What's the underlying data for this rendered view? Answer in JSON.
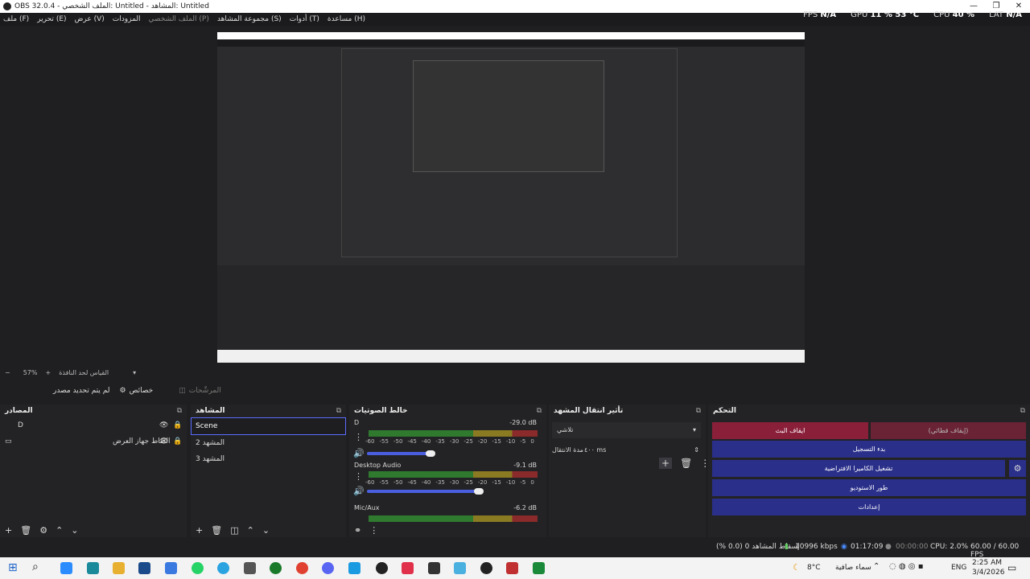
{
  "window": {
    "title": "OBS 32.0.4 - الملف الشخصي: Untitled - المشاهد: Untitled"
  },
  "menu": [
    "ملف (F)",
    "تحرير (E)",
    "عرض (V)",
    "المزودات",
    "الملف الشخصي (P)",
    "مجموعة المشاهد (S)",
    "أدوات (T)",
    "مساعدة (H)"
  ],
  "stats": {
    "fps_label": "FPS",
    "fps": "N/A",
    "gpu_label": "GPU",
    "gpu": "11 % 53 °C",
    "cpu_label": "CPU",
    "cpu": "40 %",
    "lat_label": "LAT",
    "lat": "N/A"
  },
  "zoom": {
    "value": "57%",
    "label": "القياس لحد النافذة"
  },
  "filters": {
    "no_source": "لم يتم تحديد مصدر",
    "properties": "خصائص",
    "filters": "المرشّحات"
  },
  "docks": {
    "sources": {
      "title": "المصادر",
      "items": [
        {
          "name": "D"
        },
        {
          "name": "التقاط جهاز العرض"
        }
      ]
    },
    "scenes": {
      "title": "المشاهد",
      "items": [
        "Scene",
        "المشهد 2",
        "المشهد 3"
      ]
    },
    "mixer": {
      "title": "خالط الصوتيات",
      "channels": [
        {
          "name": "D",
          "db": "-29.0 dB"
        },
        {
          "name": "Desktop Audio",
          "db": "-9.1 dB"
        },
        {
          "name": "Mic/Aux",
          "db": "-6.2 dB"
        }
      ],
      "ticks": [
        "-60",
        "-55",
        "-50",
        "-45",
        "-40",
        "-35",
        "-30",
        "-25",
        "-20",
        "-15",
        "-10",
        "-5",
        "0"
      ]
    },
    "transitions": {
      "title": "تأثير انتقال المشهد",
      "type": "تلاشي",
      "duration_label": "مدة الانتقال",
      "duration": "٤٠٠ ms"
    },
    "controls": {
      "title": "التحكم",
      "stop_stream": "ايقاف البث",
      "stop_forced": "(إيقاف قطائي)",
      "start_record": "بدء التسجيل",
      "virtual_cam": "تشغيل الكاميرا الافتراضية",
      "studio_mode": "طور الاستوديو",
      "settings": "إعدادات"
    }
  },
  "status": {
    "dropped": "إسقاط المشاهد 0 (0.0 %)",
    "kbps": "10996 kbps",
    "stream_time": "01:17:09",
    "rec_time": "00:00:00",
    "cpu": "CPU: 2.0%",
    "fps": "60.00 / 60.00 FPS"
  },
  "taskbar": {
    "weather_temp": "8°C",
    "weather_desc": "سماء صافية",
    "lang": "ENG",
    "time": "2:25 AM",
    "date": "3/4/2026"
  }
}
